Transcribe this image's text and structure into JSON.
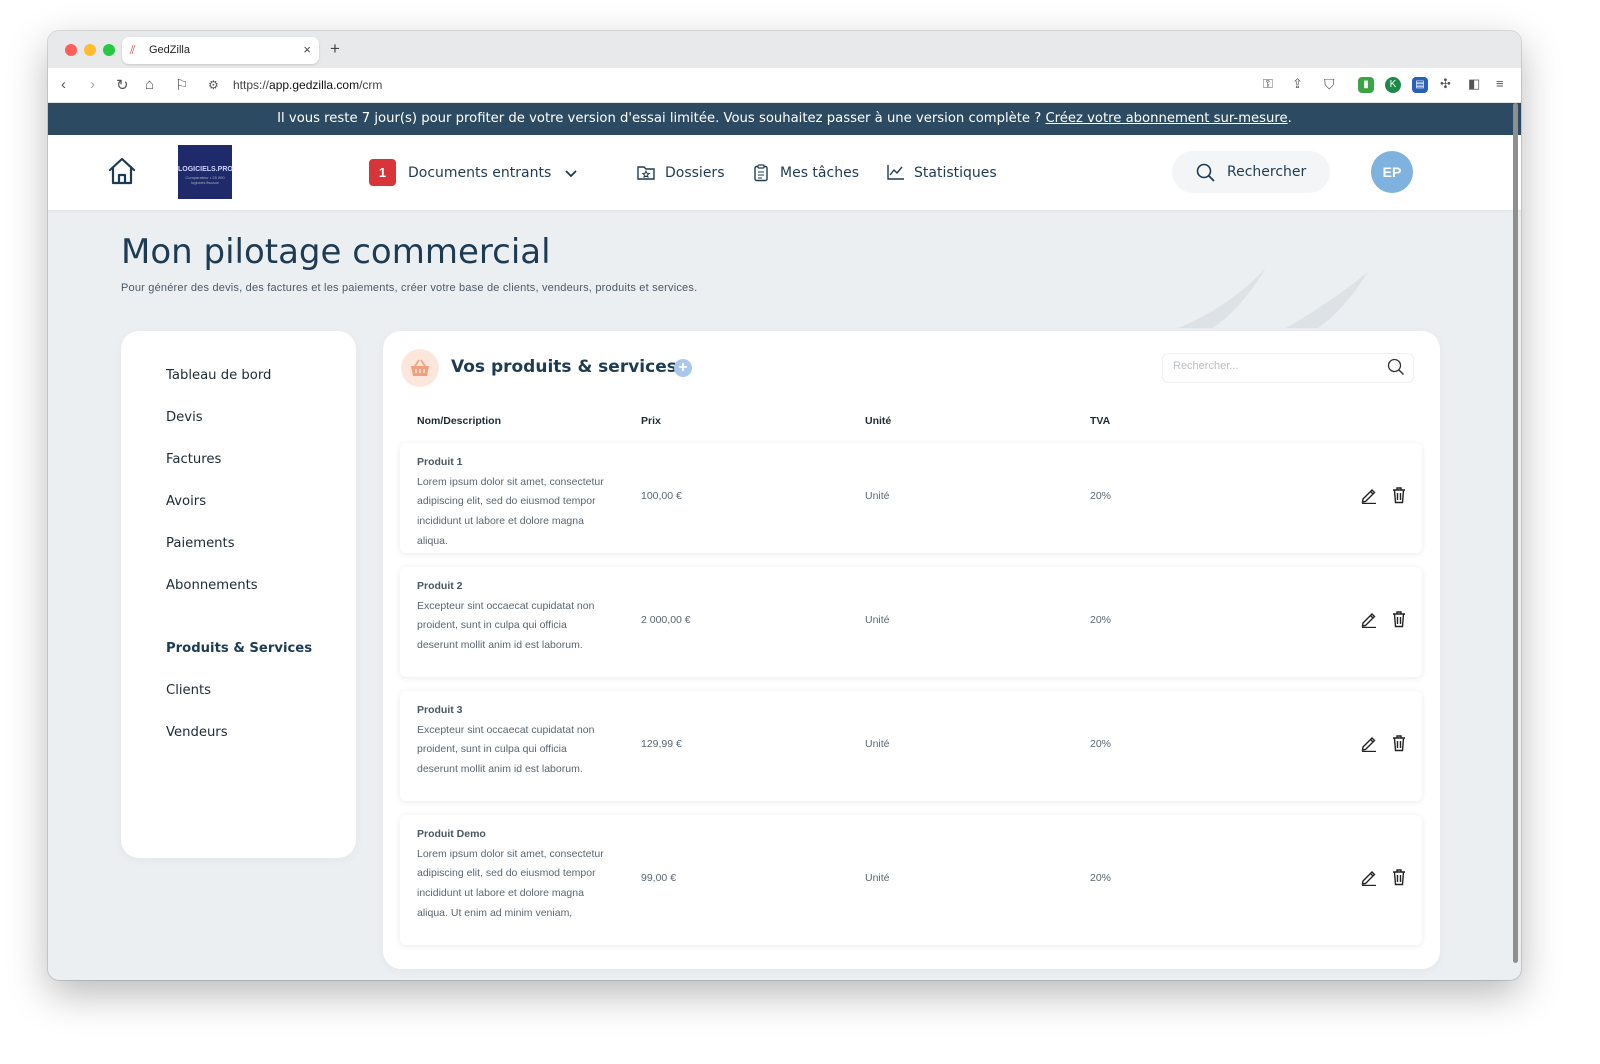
{
  "browser": {
    "tab_title": "GedZilla",
    "url_prefix": "https://",
    "url_host": "app.gedzilla.com",
    "url_path": "/crm",
    "new_tab_label": "+"
  },
  "banner": {
    "text": "Il vous reste 7 jour(s) pour profiter de votre version d'essai limitée. Vous souhaitez passer à une version complète ? ",
    "link": "Créez votre abonnement sur-mesure",
    "suffix": "."
  },
  "header": {
    "logo_text": "LOGICIELS.PRO",
    "logo_subtext": "Comparateur • 25 000 logiciels fiscaux",
    "badge_count": "1",
    "nav": [
      "Documents entrants",
      "Dossiers",
      "Mes tâches",
      "Statistiques"
    ],
    "search_label": "Rechercher",
    "avatar_initials": "EP"
  },
  "page": {
    "title": "Mon pilotage commercial",
    "subtitle": "Pour générer des devis, des factures et les paiements, créer votre base de clients, vendeurs, produits et services."
  },
  "sidebar": {
    "items": [
      "Tableau de bord",
      "Devis",
      "Factures",
      "Avoirs",
      "Paiements",
      "Abonnements",
      "Produits & Services",
      "Clients",
      "Vendeurs"
    ],
    "active": "Produits & Services"
  },
  "panel": {
    "title": "Vos produits & services",
    "add_label": "+",
    "search_placeholder": "Rechercher...",
    "columns": [
      "Nom/Description",
      "Prix",
      "Unité",
      "TVA"
    ],
    "rows": [
      {
        "name": "Produit 1",
        "desc": "Lorem ipsum dolor sit amet, consectetur adipiscing elit, sed do eiusmod tempor incididunt ut labore et dolore magna aliqua.",
        "price": "100,00 €",
        "unit": "Unité",
        "tva": "20%"
      },
      {
        "name": "Produit 2",
        "desc": "Excepteur sint occaecat cupidatat non proident, sunt in culpa qui officia deserunt mollit anim id est laborum.",
        "price": "2 000,00 €",
        "unit": "Unité",
        "tva": "20%"
      },
      {
        "name": "Produit 3",
        "desc": "Excepteur sint occaecat cupidatat non proident, sunt in culpa qui officia deserunt mollit anim id est laborum.",
        "price": "129,99 €",
        "unit": "Unité",
        "tva": "20%"
      },
      {
        "name": "Produit Demo",
        "desc": "Lorem ipsum dolor sit amet, consectetur adipiscing elit, sed do eiusmod tempor incididunt ut labore et dolore magna aliqua. Ut enim ad minim veniam,",
        "price": "99,00 €",
        "unit": "Unité",
        "tva": "20%"
      }
    ]
  },
  "colors": {
    "banner_bg": "#2c4b63",
    "primary_text": "#1d3b53",
    "badge_red": "#d8353b",
    "avatar_blue": "#7fb2de",
    "page_bg": "#eceff2"
  },
  "icons": [
    "home-icon",
    "chevron-down-icon",
    "folder-star-icon",
    "clipboard-icon",
    "chart-line-icon",
    "search-icon",
    "basket-icon",
    "plus-icon",
    "edit-icon",
    "trash-icon"
  ]
}
